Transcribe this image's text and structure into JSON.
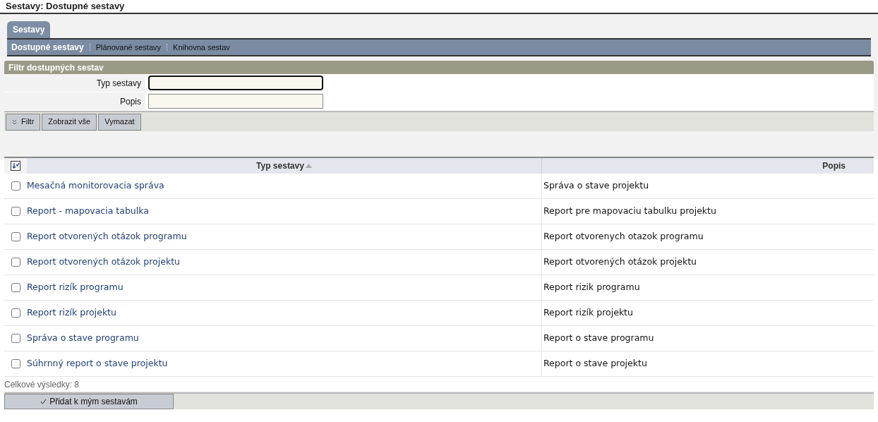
{
  "page_title": "Sestavy: Dostupné sestavy",
  "tabs": [
    {
      "label": "Sestavy",
      "selected": true
    }
  ],
  "subnav": [
    {
      "label": "Dostupné sestavy",
      "selected": true
    },
    {
      "label": "Plánované sestavy",
      "selected": false
    },
    {
      "label": "Knihovna sestav",
      "selected": false
    }
  ],
  "filter": {
    "title": "Filtr dostupných sestav",
    "fields": [
      {
        "label": "Typ sestavy",
        "focused": true
      },
      {
        "label": "Popis",
        "focused": false
      }
    ],
    "buttons": [
      {
        "label": "Filtr",
        "kind": "toggle"
      },
      {
        "label": "Zobrazit vše",
        "kind": "plain"
      },
      {
        "label": "Vymazat",
        "kind": "plain"
      }
    ]
  },
  "table": {
    "columns": [
      {
        "label": "Typ sestavy",
        "sorted": true
      },
      {
        "label": "Popis",
        "sorted": false
      }
    ],
    "rows": [
      {
        "checked": false,
        "name": "Mesačná monitorovacia správa",
        "description": "Správa o stave projektu"
      },
      {
        "checked": false,
        "name": "Report - mapovacia tabulka",
        "description": "Report pre mapovaciu tabulku projektu"
      },
      {
        "checked": false,
        "name": "Report otvorených otázok programu",
        "description": "Report otvorenych otazok programu"
      },
      {
        "checked": false,
        "name": "Report otvorených otázok projektu",
        "description": "Report otvorených otázok projektu"
      },
      {
        "checked": false,
        "name": "Report rizík programu",
        "description": "Report rizik programu"
      },
      {
        "checked": false,
        "name": "Report rizík projektu",
        "description": "Report rizík projektu"
      },
      {
        "checked": false,
        "name": "Správa o stave programu",
        "description": "Report o stave programu"
      },
      {
        "checked": false,
        "name": "Súhrnný report o stave projektu",
        "description": "Report o stave projektu"
      }
    ]
  },
  "total": "Celkové výsledky: 8",
  "action_button": "Přidat k mým sestavám"
}
